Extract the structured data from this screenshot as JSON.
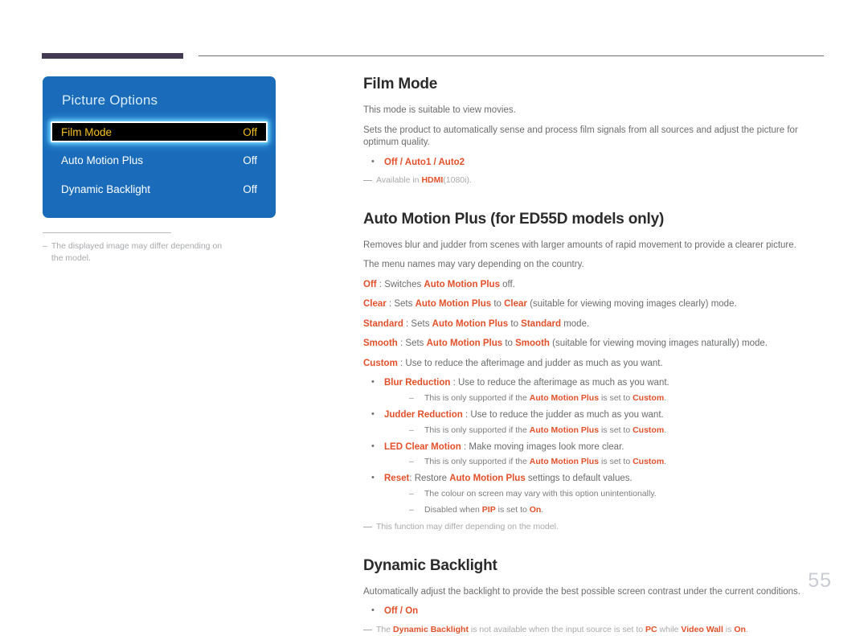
{
  "page": {
    "number": "55"
  },
  "osd": {
    "title": "Picture Options",
    "rows": [
      {
        "label": "Film Mode",
        "value": "Off",
        "selected": true
      },
      {
        "label": "Auto Motion Plus",
        "value": "Off",
        "selected": false
      },
      {
        "label": "Dynamic Backlight",
        "value": "Off",
        "selected": false
      }
    ],
    "note": {
      "dash": "–",
      "text": "The displayed image may differ depending on the model."
    },
    "colors": {
      "panel_bg": "#1a6cbb",
      "selected_bg": "#000000",
      "selected_text": "#f5c020",
      "glow": "#78dcff"
    }
  },
  "sections": [
    {
      "id": "film-mode",
      "title": "Film Mode",
      "body": [
        "This mode is suitable to view movies.",
        "Sets the product to automatically sense and process film signals from all sources and adjust the picture for optimum quality."
      ],
      "bullet_options": "Off / Auto1 / Auto2",
      "tail_note": {
        "pre": "Available in ",
        "accent": "HDMI",
        "post": "(1080i)."
      }
    },
    {
      "id": "auto-motion-plus",
      "title": "Auto Motion Plus (for ED55D models only)",
      "body": [
        "Removes blur and judder from scenes with larger amounts of rapid movement to provide a clearer picture.",
        "The menu names may vary depending on the country."
      ],
      "definitions": [
        {
          "term": "Off",
          "sep": " : Switches ",
          "ref": "Auto Motion Plus",
          "tail": " off."
        },
        {
          "term": "Clear",
          "sep": " : Sets ",
          "ref": "Auto Motion Plus",
          "mid": " to ",
          "term2": "Clear",
          "tail": " (suitable for viewing moving images clearly) mode."
        },
        {
          "term": "Standard",
          "sep": " : Sets ",
          "ref": "Auto Motion Plus",
          "mid": " to ",
          "term2": "Standard",
          "tail": " mode."
        },
        {
          "term": "Smooth",
          "sep": " : Sets ",
          "ref": "Auto Motion Plus",
          "mid": " to ",
          "term2": "Smooth",
          "tail": " (suitable for viewing moving images naturally) mode."
        },
        {
          "term": "Custom",
          "sep": " : Use to reduce the afterimage and judder as much as you want.",
          "ref": "",
          "tail": ""
        }
      ],
      "bullets": [
        {
          "term": "Blur Reduction",
          "text": " : Use to reduce the afterimage as much as you want.",
          "subs": [
            {
              "pre": "This is only supported if the ",
              "ref": "Auto Motion Plus",
              "mid": " is set to ",
              "val": "Custom",
              "post": "."
            }
          ]
        },
        {
          "term": "Judder Reduction",
          "text": " : Use to reduce the judder as much as you want.",
          "subs": [
            {
              "pre": "This is only supported if the ",
              "ref": "Auto Motion Plus",
              "mid": " is set to ",
              "val": "Custom",
              "post": "."
            }
          ]
        },
        {
          "term": "LED Clear Motion",
          "text": " : Make moving images look more clear.",
          "subs": [
            {
              "pre": "This is only supported if the ",
              "ref": "Auto Motion Plus",
              "mid": " is set to ",
              "val": "Custom",
              "post": "."
            }
          ]
        },
        {
          "term": "Reset",
          "text": ": Restore ",
          "ref": "Auto Motion Plus",
          "text2": " settings to default values.",
          "subs": [
            {
              "pre": "The colour on screen may vary with this option unintentionally.",
              "ref": "",
              "mid": "",
              "val": "",
              "post": ""
            },
            {
              "pre": "Disabled when ",
              "ref": "PIP",
              "mid": " is set to ",
              "val": "On",
              "post": "."
            }
          ]
        }
      ],
      "tail_note": {
        "pre": "This function may differ depending on the model.",
        "accent": "",
        "post": ""
      }
    },
    {
      "id": "dynamic-backlight",
      "title": "Dynamic Backlight",
      "body": [
        "Automatically adjust the backlight to provide the best possible screen contrast under the current conditions."
      ],
      "bullet_options": "Off / On",
      "tail_note_rich": {
        "p1": "The ",
        "a1": "Dynamic Backlight",
        "p2": " is not available when the input source is set to ",
        "a2": "PC",
        "p3": " while ",
        "a3": "Video Wall",
        "p4": " is ",
        "a4": "On",
        "p5": "."
      }
    }
  ],
  "colors": {
    "accent": "#e4502a",
    "heading": "#2b2b2b",
    "body": "#6a6c6e",
    "note": "#a7a9ac",
    "rule_thick": "#413a50",
    "rule_thin": "#6d6e71"
  }
}
